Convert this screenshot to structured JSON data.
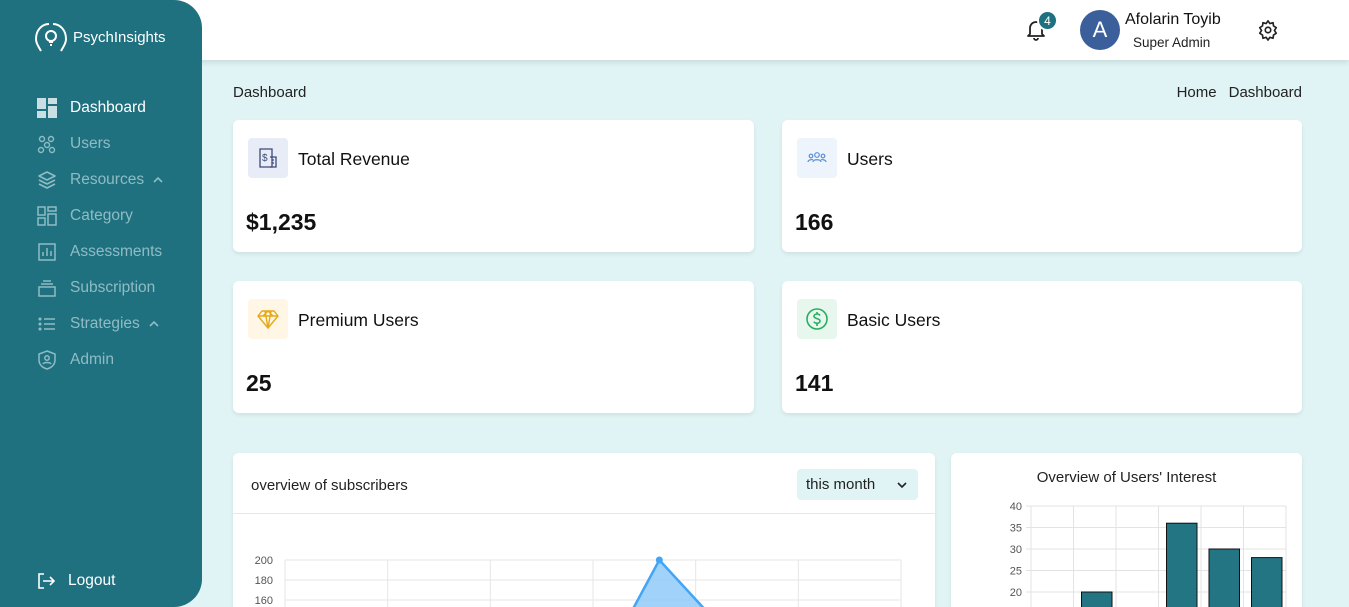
{
  "app": {
    "name": "PsychInsights"
  },
  "sidebar": {
    "items": [
      {
        "label": "Dashboard",
        "icon": "dashboard-icon",
        "active": true
      },
      {
        "label": "Users",
        "icon": "users-icon"
      },
      {
        "label": "Resources",
        "icon": "layers-icon",
        "expandable": true
      },
      {
        "label": "Category",
        "icon": "category-icon"
      },
      {
        "label": "Assessments",
        "icon": "assessment-icon"
      },
      {
        "label": "Subscription",
        "icon": "subscription-icon"
      },
      {
        "label": "Strategies",
        "icon": "list-icon",
        "expandable": true
      },
      {
        "label": "Admin",
        "icon": "admin-shield-icon"
      }
    ],
    "logout_label": "Logout"
  },
  "header": {
    "notifications_count": "4",
    "user": {
      "initial": "A",
      "name": "Afolarin Toyib",
      "role": "Super Admin"
    }
  },
  "page": {
    "title": "Dashboard",
    "breadcrumb": [
      "Home",
      "Dashboard"
    ]
  },
  "stats": [
    {
      "title": "Total Revenue",
      "value": "$1,235",
      "icon": "revenue-icon",
      "icon_bg": "#e8ecf6"
    },
    {
      "title": "Users",
      "value": "166",
      "icon": "users-group-icon",
      "icon_bg": "#eef4fc"
    },
    {
      "title": "Premium Users",
      "value": "25",
      "icon": "diamond-icon",
      "icon_bg": "#fff6e6"
    },
    {
      "title": "Basic Users",
      "value": "141",
      "icon": "dollar-icon",
      "icon_bg": "#e8f7ee"
    }
  ],
  "subscribers": {
    "title": "overview of subscribers",
    "period": "this month"
  },
  "interest": {
    "title": "Overview of Users' Interest"
  },
  "chart_data": [
    {
      "type": "area",
      "y_ticks": [
        200,
        180,
        160
      ],
      "ylim_visible": [
        160,
        200
      ],
      "points_visible": [
        {
          "index": 5,
          "y": 200
        }
      ],
      "color": "#42a5f5"
    },
    {
      "type": "bar",
      "title": "Overview of Users' Interest",
      "y_ticks": [
        40,
        35,
        30,
        25,
        20
      ],
      "ylim_visible": [
        20,
        40
      ],
      "values": [
        null,
        20,
        null,
        36,
        30,
        28
      ],
      "color": "#237584"
    }
  ]
}
